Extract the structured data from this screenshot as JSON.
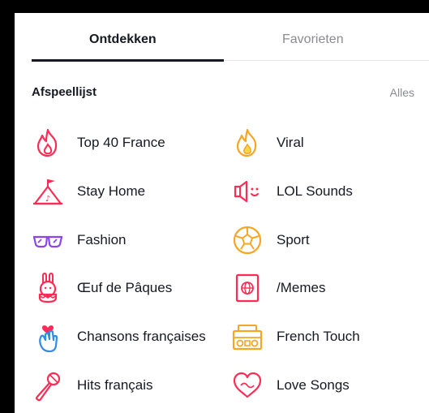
{
  "tabs": [
    {
      "label": "Ontdekken",
      "active": true
    },
    {
      "label": "Favorieten",
      "active": false
    }
  ],
  "section": {
    "title": "Afspeellijst",
    "more_label": "Alles"
  },
  "playlists": [
    {
      "label": "Top 40 France",
      "icon": "flame-icon"
    },
    {
      "label": "Viral",
      "icon": "viral-flame-icon"
    },
    {
      "label": "Stay Home",
      "icon": "tent-icon"
    },
    {
      "label": "LOL Sounds",
      "icon": "speaker-smile-icon"
    },
    {
      "label": "Fashion",
      "icon": "sunglasses-icon"
    },
    {
      "label": "Sport",
      "icon": "soccer-ball-icon"
    },
    {
      "label": "Œuf de Pâques",
      "icon": "easter-bunny-icon"
    },
    {
      "label": "/Memes",
      "icon": "globe-card-icon"
    },
    {
      "label": "Chansons françaises",
      "icon": "heart-hand-icon"
    },
    {
      "label": "French Touch",
      "icon": "radio-icon"
    },
    {
      "label": "Hits français",
      "icon": "microphone-icon"
    },
    {
      "label": "Love Songs",
      "icon": "heart-icon"
    }
  ],
  "colors": {
    "text": "#161823",
    "muted": "#8a8b91",
    "divider": "#e6e6e8"
  }
}
